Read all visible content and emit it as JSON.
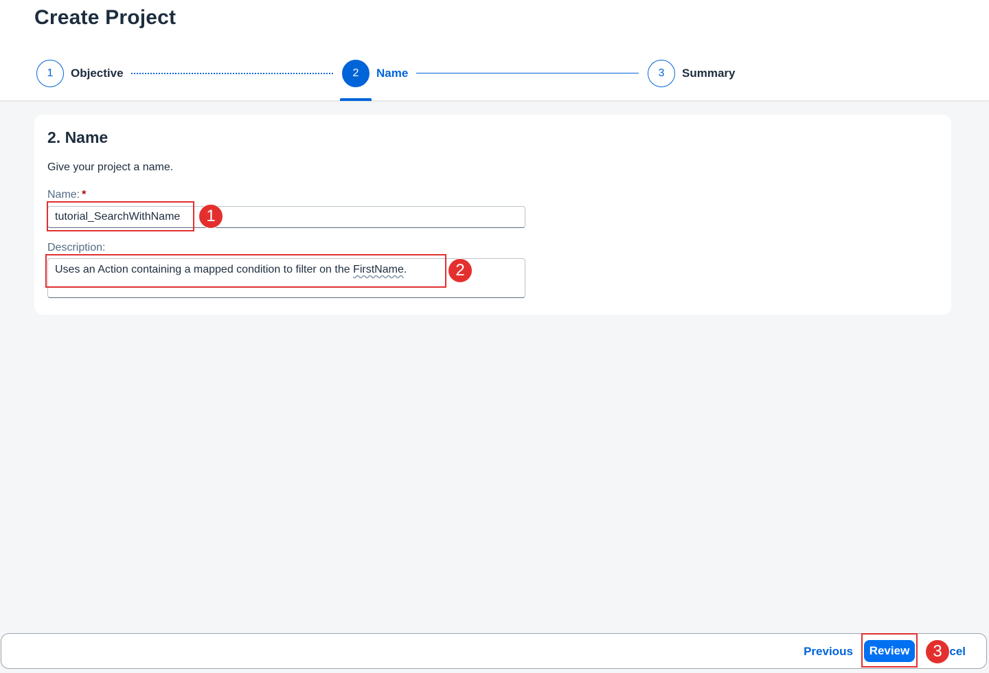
{
  "page": {
    "title": "Create Project"
  },
  "wizard": {
    "steps": [
      {
        "number": "1",
        "label": "Objective",
        "state": "completed"
      },
      {
        "number": "2",
        "label": "Name",
        "state": "active"
      },
      {
        "number": "3",
        "label": "Summary",
        "state": "upcoming"
      }
    ]
  },
  "form": {
    "section_title": "2. Name",
    "section_description": "Give your project a name.",
    "name_label": "Name:",
    "name_required_marker": "*",
    "name_value": "tutorial_SearchWithName",
    "description_label": "Description:",
    "description_value_prefix": "Uses an Action containing a mapped condition to filter on the ",
    "description_value_misspelled": "FirstName",
    "description_value_suffix": "."
  },
  "annotations": {
    "markers": [
      "1",
      "2",
      "3"
    ],
    "color": "#e3302f"
  },
  "footer": {
    "previous_label": "Previous",
    "review_label": "Review",
    "cancel_label": "cel"
  },
  "colors": {
    "accent": "#0064d9",
    "primary_button": "#0070f2",
    "required": "#aa0808",
    "annotation": "#e3302f"
  }
}
